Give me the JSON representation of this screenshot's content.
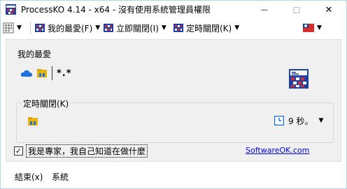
{
  "window": {
    "title": "ProcessKO 4.14 - x64 - 沒有使用系統管理員權限",
    "min_glyph": "—",
    "max_glyph": "☐",
    "close_glyph": "✕"
  },
  "toolbar": {
    "favorites_label": "我的最愛(F)",
    "kill_now_label": "立即關閉(I)",
    "timed_kill_label": "定時關閉(K)",
    "dropdown_glyph": "▼"
  },
  "favorites": {
    "group_label": "我的最愛",
    "pattern": "*.*"
  },
  "timer": {
    "group_label": "定時關閉(K)",
    "value": "9 秒。",
    "dropdown_glyph": "▼"
  },
  "expert": {
    "checked_glyph": "✓",
    "label": "我是專家，我自己知道在做什麼"
  },
  "link": {
    "text": "SoftwareOK.com"
  },
  "bottom_menu": {
    "exit_label": "結束(x)",
    "system_label": "系統"
  },
  "colors": {
    "accent_blue": "#1e6fd9",
    "icon_red": "#d32f2f",
    "folder_yellow": "#e8b400",
    "link_color": "#0000ee"
  }
}
